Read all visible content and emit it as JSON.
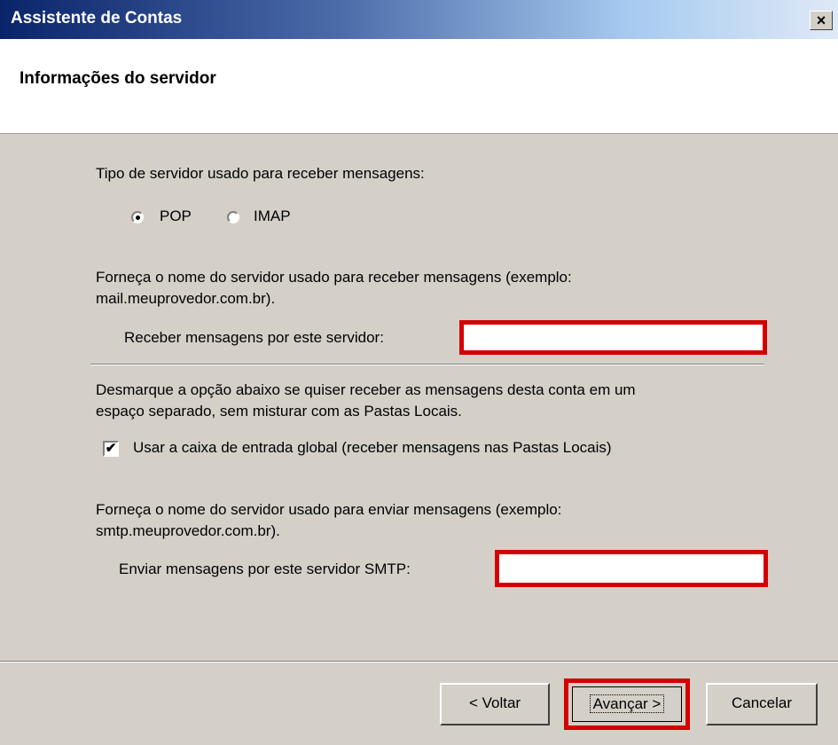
{
  "window": {
    "title": "Assistente de Contas",
    "close_glyph": "×"
  },
  "header": {
    "title": "Informações do servidor"
  },
  "incoming": {
    "server_type_prompt": "Tipo de servidor usado para receber mensagens:",
    "options": [
      {
        "label": "POP",
        "selected": true
      },
      {
        "label": "IMAP",
        "selected": false
      }
    ],
    "instructions_line1": "Forneça o nome do servidor usado para receber mensagens (exemplo:",
    "instructions_line2": "mail.meuprovedor.com.br).",
    "field_label": "Receber mensagens por este servidor:",
    "field_value": ""
  },
  "global_inbox": {
    "note_line1": "Desmarque a opção abaixo se quiser receber as mensagens desta conta em um",
    "note_line2": "espaço separado, sem misturar com as Pastas Locais.",
    "checkbox_label": "Usar a caixa de entrada global (receber mensagens nas Pastas Locais)",
    "checked": true,
    "check_glyph": "✔"
  },
  "outgoing": {
    "instructions_line1": "Forneça o nome do servidor usado para enviar mensagens (exemplo:",
    "instructions_line2": "smtp.meuprovedor.com.br).",
    "field_label": "Enviar mensagens por este servidor SMTP:",
    "field_value": ""
  },
  "buttons": {
    "back": "< Voltar",
    "next": "Avançar >",
    "cancel": "Cancelar"
  },
  "colors": {
    "highlight": "#d40000",
    "titlebar": "#0a246a",
    "dialog_bg": "#d4d0c8"
  }
}
